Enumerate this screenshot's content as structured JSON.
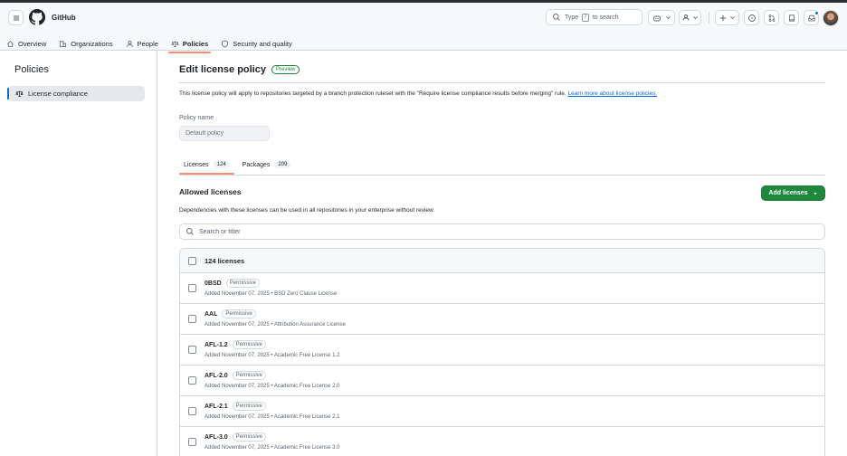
{
  "app": {
    "brand": "GitHub"
  },
  "search": {
    "before": "Type",
    "key": "/",
    "after": "to search"
  },
  "nav": [
    {
      "label": "Overview",
      "icon": "home-icon"
    },
    {
      "label": "Organizations",
      "icon": "organization-icon"
    },
    {
      "label": "People",
      "icon": "person-icon"
    },
    {
      "label": "Policies",
      "icon": "law-icon",
      "active": true
    },
    {
      "label": "Security and quality",
      "icon": "shield-icon"
    }
  ],
  "sidebar": {
    "title": "Policies",
    "items": [
      {
        "label": "License compliance",
        "icon": "law-icon",
        "selected": true
      }
    ]
  },
  "main": {
    "title": "Edit license policy",
    "badge": "Preview",
    "description": "This license policy will apply to repositories targeted by a branch protection ruleset with the \"Require license compliance results before merging\" rule.",
    "learn_more": "Learn more about license policies.",
    "policy_label": "Policy name",
    "policy_placeholder": "Default policy",
    "tabs": [
      {
        "label": "Licenses",
        "count": "124",
        "active": true
      },
      {
        "label": "Packages",
        "count": "209",
        "active": false
      }
    ],
    "section_title": "Allowed licenses",
    "add_button": "Add licenses",
    "section_desc": "Dependencies with these licenses can be used in all repositories in your enterprise without review.",
    "filter_placeholder": "Search or filter",
    "list_header": "124 licenses",
    "rows": [
      {
        "id": "0BSD",
        "badge": "Permissive",
        "meta": "Added November 07, 2025 • BSD Zero Clause License"
      },
      {
        "id": "AAL",
        "badge": "Permissive",
        "meta": "Added November 07, 2025 • Attribution Assurance License"
      },
      {
        "id": "AFL-1.2",
        "badge": "Permissive",
        "meta": "Added November 07, 2025 • Academic Free License 1.2"
      },
      {
        "id": "AFL-2.0",
        "badge": "Permissive",
        "meta": "Added November 07, 2025 • Academic Free License 2.0"
      },
      {
        "id": "AFL-2.1",
        "badge": "Permissive",
        "meta": "Added November 07, 2025 • Academic Free License 2.1"
      },
      {
        "id": "AFL-3.0",
        "badge": "Permissive",
        "meta": "Added November 07, 2025 • Academic Free License 3.0"
      }
    ]
  },
  "colors": {
    "accent": "#fd8c73",
    "primary_button": "#1f883d",
    "link": "#0969da",
    "preview_badge": "#1a7f37"
  }
}
